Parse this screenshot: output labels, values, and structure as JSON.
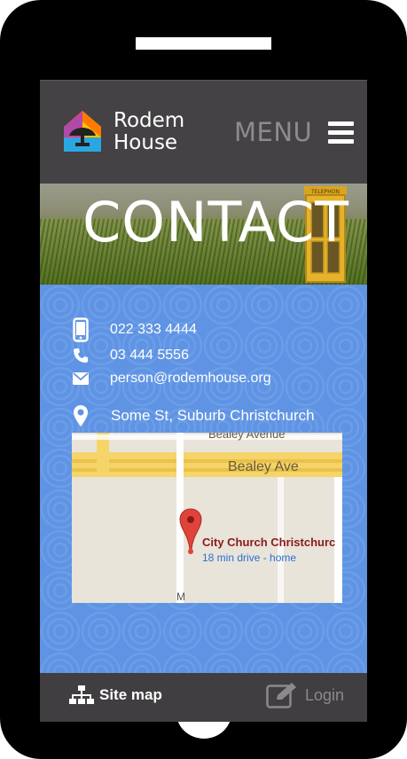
{
  "header": {
    "brand_line1": "Rodem",
    "brand_line2": "House",
    "menu_label": "MENU"
  },
  "hero": {
    "title": "CONTACT",
    "booth_sign": "TELEPHON"
  },
  "contact": {
    "mobile": "022 333 4444",
    "phone": "03 444 5556",
    "email": "person@rodemhouse.org",
    "address": "Some St, Suburb Christchurch"
  },
  "map": {
    "street_top": "Bealey Avenue",
    "street_main": "Bealey Ave",
    "side_street_letter": "M",
    "place_name": "City Church Christchurc",
    "drive_info": "18 min drive - home"
  },
  "footer": {
    "sitemap_label": "Site map",
    "login_label": "Login"
  },
  "colors": {
    "background_blue": "#5f93e3",
    "header_dark": "#444244",
    "footer_dark": "#403e40",
    "map_pin": "#e0433a"
  },
  "icons": [
    "mobile-icon",
    "phone-icon",
    "envelope-icon",
    "map-marker-icon",
    "sitemap-icon",
    "edit-icon",
    "hamburger-icon"
  ]
}
